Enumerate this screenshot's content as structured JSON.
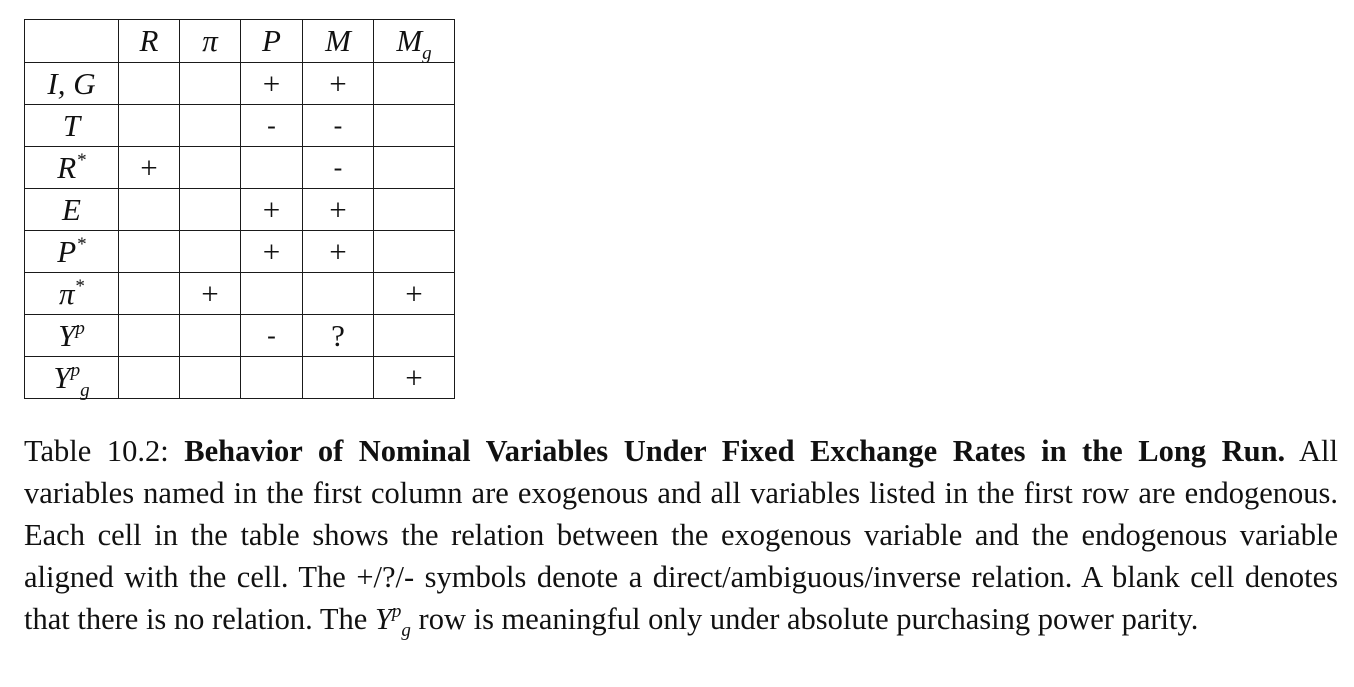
{
  "table": {
    "columns": [
      {
        "base": "",
        "sup": "",
        "sub": ""
      },
      {
        "base": "R",
        "sup": "",
        "sub": ""
      },
      {
        "base": "π",
        "sup": "",
        "sub": ""
      },
      {
        "base": "P",
        "sup": "",
        "sub": ""
      },
      {
        "base": "M",
        "sup": "",
        "sub": ""
      },
      {
        "base": "M",
        "sup": "",
        "sub": "g"
      }
    ],
    "rows": [
      {
        "label": {
          "base": "I, G",
          "sup": "",
          "sub": ""
        },
        "cells": [
          "",
          "",
          "+",
          "+",
          ""
        ]
      },
      {
        "label": {
          "base": "T",
          "sup": "",
          "sub": ""
        },
        "cells": [
          "",
          "",
          "-",
          "-",
          ""
        ]
      },
      {
        "label": {
          "base": "R",
          "sup": "*",
          "sub": ""
        },
        "cells": [
          "+",
          "",
          "",
          "-",
          ""
        ]
      },
      {
        "label": {
          "base": "E",
          "sup": "",
          "sub": ""
        },
        "cells": [
          "",
          "",
          "+",
          "+",
          ""
        ]
      },
      {
        "label": {
          "base": "P",
          "sup": "*",
          "sub": ""
        },
        "cells": [
          "",
          "",
          "+",
          "+",
          ""
        ]
      },
      {
        "label": {
          "base": "π",
          "sup": "*",
          "sub": ""
        },
        "cells": [
          "",
          "+",
          "",
          "",
          "+"
        ]
      },
      {
        "label": {
          "base": "Y",
          "sup": "p",
          "sub": ""
        },
        "cells": [
          "",
          "",
          "-",
          "?",
          ""
        ]
      },
      {
        "label": {
          "base": "Y",
          "sup": "p",
          "sub": "g"
        },
        "cells": [
          "",
          "",
          "",
          "",
          "+"
        ]
      }
    ]
  },
  "caption": {
    "label": "Table 10.2:",
    "title": "Behavior of Nominal Variables Under Fixed Exchange Rates in the Long Run.",
    "body": "All variables named in the first column are exogenous and all variables listed in the first row are endogenous. Each cell in the table shows the relation between the exogenous variable and the endogenous variable aligned with the cell. The +/?/- symbols denote a direct/ambiguous/inverse relation. A blank cell denotes that there is no relation.",
    "last_line_pre": "The",
    "last_line_var": "Y",
    "last_line_sup": "p",
    "last_line_sub": "g",
    "last_line_post": "row is meaningful only under absolute purchasing power parity."
  }
}
